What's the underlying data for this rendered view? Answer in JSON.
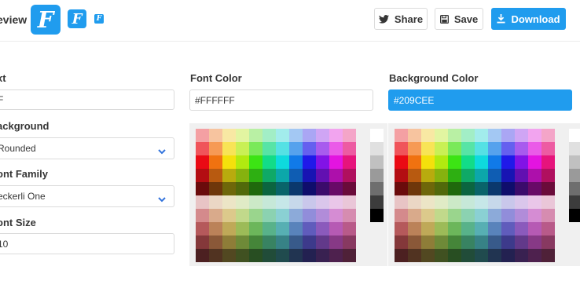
{
  "header": {
    "preview_label": "eview",
    "favicon_letter": "F",
    "share_label": "Share",
    "save_label": "Save",
    "download_label": "Download"
  },
  "form": {
    "text": {
      "label": "xt",
      "value": "F"
    },
    "background": {
      "label": "ackground",
      "value": "Rounded"
    },
    "font_family": {
      "label": "ont Family",
      "value": "eckerli One"
    },
    "font_size": {
      "label": "ont Size",
      "value": "10"
    },
    "font_color": {
      "label": "Font Color",
      "value": "#FFFFFF"
    },
    "background_color": {
      "label": "Background Color",
      "value": "#209CEE"
    }
  },
  "colors": {
    "accent": "#209cee",
    "swatch_grid": [
      [
        "#f4a0a3",
        "#f7c49f",
        "#f8e8a3",
        "#e2f5a1",
        "#b9f0a4",
        "#a2eec6",
        "#a2ecec",
        "#a3c8f3",
        "#aaa6f4",
        "#cfa5f4",
        "#f2a4ef",
        "#f4a5c8"
      ],
      [
        "#f0545a",
        "#f69a55",
        "#f8e456",
        "#c9f055",
        "#7ae95a",
        "#57e4a6",
        "#55e1e4",
        "#56a2ed",
        "#6560ef",
        "#a85bee",
        "#ea5be8",
        "#ed5ba2"
      ],
      [
        "#ea0a14",
        "#f07210",
        "#f4e00c",
        "#b1ea10",
        "#3ce414",
        "#12dc88",
        "#0edadd",
        "#117ae8",
        "#2019e9",
        "#8213e6",
        "#e314e0",
        "#e6147c"
      ],
      [
        "#b30d12",
        "#b85a10",
        "#b8ab0e",
        "#86b20f",
        "#2eaf12",
        "#0fa967",
        "#0ca7aa",
        "#0f5db3",
        "#1814b3",
        "#6210b1",
        "#ad10ab",
        "#b0105f"
      ],
      [
        "#6a0b0c",
        "#6e370b",
        "#6e670a",
        "#51690b",
        "#1f690c",
        "#0b6540",
        "#09646a",
        "#0b386d",
        "#0f0d6c",
        "#3b0b6b",
        "#680a67",
        "#6a0b3a"
      ],
      [
        "#e8c4c5",
        "#ebd7c5",
        "#ece5c6",
        "#e0ebc6",
        "#cce9c7",
        "#c6e8d8",
        "#c6e7e8",
        "#c7d8ea",
        "#c9c7eb",
        "#dac6eb",
        "#eac6e9",
        "#eac6d8"
      ],
      [
        "#d48a8c",
        "#d9aa8b",
        "#dcc98b",
        "#c1d98b",
        "#9ad58d",
        "#8bd2b1",
        "#8ad0d3",
        "#8caad9",
        "#918dda",
        "#b18cd9",
        "#d58cd3",
        "#d68cb0"
      ],
      [
        "#b5595b",
        "#bb8259",
        "#bfa958",
        "#9cbb58",
        "#6cb65b",
        "#58b28a",
        "#57afb3",
        "#5983bb",
        "#605cbc",
        "#8b5abc",
        "#b65ab4",
        "#b85a89"
      ],
      [
        "#84383a",
        "#8a5838",
        "#8e7d38",
        "#6e8a38",
        "#458539",
        "#388362",
        "#378286",
        "#385a8a",
        "#3d3a8b",
        "#62398a",
        "#873986",
        "#883961"
      ],
      [
        "#4c2021",
        "#513321",
        "#524821",
        "#405121",
        "#284e22",
        "#214c39",
        "#204b4e",
        "#213451",
        "#232151",
        "#392151",
        "#4e214e",
        "#4f2138"
      ]
    ],
    "gray_column": [
      "#ffffff",
      "#e0e0e0",
      "#c0c0c0",
      "#9a9a9a",
      "#6e6e6e",
      "#3c3c3c",
      "#000000"
    ]
  },
  "icons": {
    "share": "twitter-bird-icon",
    "save": "floppy-disk-icon",
    "download": "download-arrow-icon",
    "select_arrow": "chevron-down-icon"
  }
}
